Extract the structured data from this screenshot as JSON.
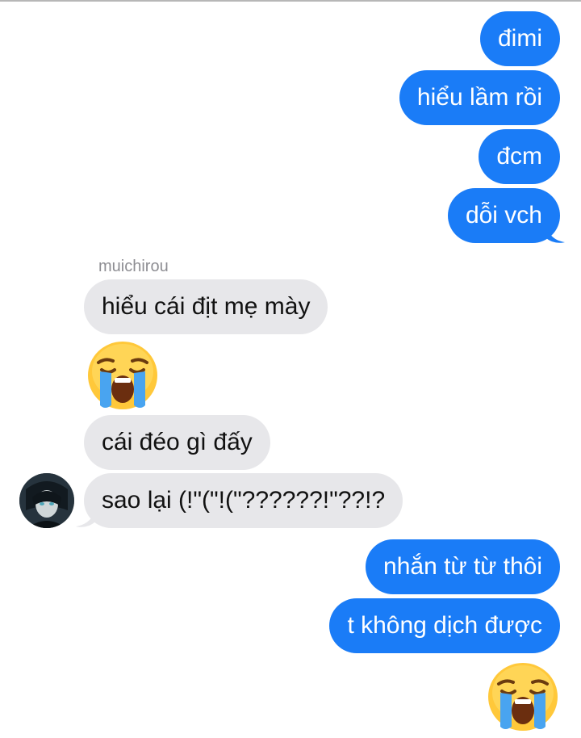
{
  "conversation": {
    "messages_top": [
      {
        "text": "đimi"
      },
      {
        "text": "hiểu lầm rồi"
      },
      {
        "text": "đcm"
      },
      {
        "text": "dỗi vch"
      }
    ],
    "contact": {
      "name": "muichiro u"
    },
    "incoming": [
      {
        "text": "hiểu cái địt mẹ mày"
      },
      {
        "emoji": "crying-face"
      },
      {
        "text": "cái đéo gì đấy"
      },
      {
        "text": "sao lại (!\"(\"!(\"??????!\"??!?"
      }
    ],
    "messages_bottom": [
      {
        "text": "nhắn từ từ thôi"
      },
      {
        "text": "t không dịch được"
      },
      {
        "emoji": "crying-face"
      }
    ]
  },
  "colors": {
    "outgoing_bubble": "#1a7cf7",
    "incoming_bubble": "#e7e7ea",
    "sender_name": "#8e8e93"
  }
}
